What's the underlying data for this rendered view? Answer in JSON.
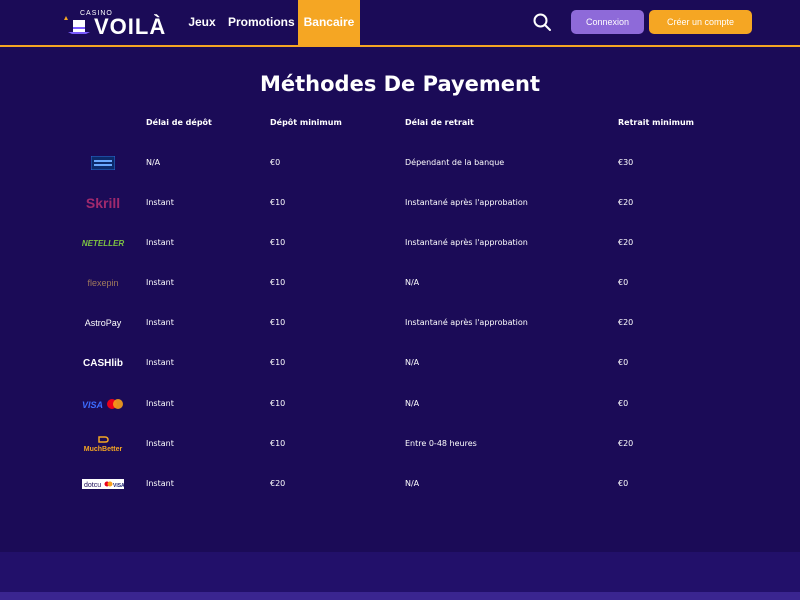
{
  "header": {
    "logo_small": "CASINO",
    "logo_big": "VOILÀ",
    "nav": [
      {
        "label": "Jeux"
      },
      {
        "label": "Promotions"
      },
      {
        "label": "Bancaire",
        "active": true
      }
    ],
    "login_label": "Connexion",
    "register_label": "Créer un compte",
    "accent_color": "#f5a623",
    "login_color": "#8e6ad9"
  },
  "page": {
    "title": "Méthodes De Payement",
    "background": "#1b0b57"
  },
  "table": {
    "columns": [
      "Délai de dépôt",
      "Dépôt minimum",
      "Délai de retrait",
      "Retrait minimum"
    ],
    "rows": [
      {
        "method": "Virement bancaire",
        "icon": "bank-transfer-logo",
        "deposit_delay": "N/A",
        "deposit_min": "€0",
        "withdraw_delay": "Dépendant de la banque",
        "withdraw_min": "€30"
      },
      {
        "method": "Skrill",
        "icon": "skrill-logo",
        "deposit_delay": "Instant",
        "deposit_min": "€10",
        "withdraw_delay": "Instantané après l'approbation",
        "withdraw_min": "€20"
      },
      {
        "method": "NETELLER",
        "icon": "neteller-logo",
        "deposit_delay": "Instant",
        "deposit_min": "€10",
        "withdraw_delay": "Instantané après l'approbation",
        "withdraw_min": "€20"
      },
      {
        "method": "flexepin",
        "icon": "flexepin-logo",
        "deposit_delay": "Instant",
        "deposit_min": "€10",
        "withdraw_delay": "N/A",
        "withdraw_min": "€0"
      },
      {
        "method": "AstroPay",
        "icon": "astropay-logo",
        "deposit_delay": "Instant",
        "deposit_min": "€10",
        "withdraw_delay": "Instantané après l'approbation",
        "withdraw_min": "€20"
      },
      {
        "method": "CASHlib",
        "icon": "cashlib-logo",
        "deposit_delay": "Instant",
        "deposit_min": "€10",
        "withdraw_delay": "N/A",
        "withdraw_min": "€0"
      },
      {
        "method": "VISA Mastercard",
        "icon": "visa-mastercard-logo",
        "deposit_delay": "Instant",
        "deposit_min": "€10",
        "withdraw_delay": "N/A",
        "withdraw_min": "€0"
      },
      {
        "method": "MuchBetter",
        "icon": "muchbetter-logo",
        "deposit_delay": "Instant",
        "deposit_min": "€10",
        "withdraw_delay": "Entre 0-48 heures",
        "withdraw_min": "€20"
      },
      {
        "method": "dotcu",
        "icon": "dotcu-cards-logo",
        "deposit_delay": "Instant",
        "deposit_min": "€20",
        "withdraw_delay": "N/A",
        "withdraw_min": "€0"
      }
    ]
  }
}
